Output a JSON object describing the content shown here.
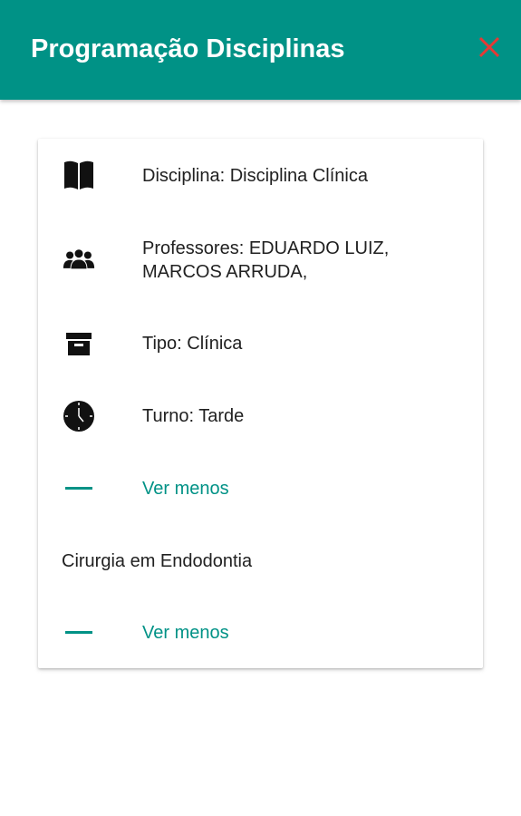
{
  "app_bar": {
    "title": "Programação Disciplinas",
    "close_icon": "close-icon",
    "background": "#009286",
    "close_color": "#e53935"
  },
  "card": {
    "rows": [
      {
        "icon": "book-icon",
        "text": "Disciplina: Disciplina Clínica"
      },
      {
        "icon": "group-icon",
        "line1": "Professores: EDUARDO LUIZ,",
        "line2": "MARCOS ARRUDA,"
      },
      {
        "icon": "archive-icon",
        "text": "Tipo: Clínica"
      },
      {
        "icon": "clock-icon",
        "text": "Turno: Tarde"
      }
    ],
    "toggle_1": {
      "icon": "minus-icon",
      "label": "Ver menos"
    },
    "subject": "Cirurgia em Endodontia",
    "toggle_2": {
      "icon": "minus-icon",
      "label": "Ver menos"
    }
  }
}
